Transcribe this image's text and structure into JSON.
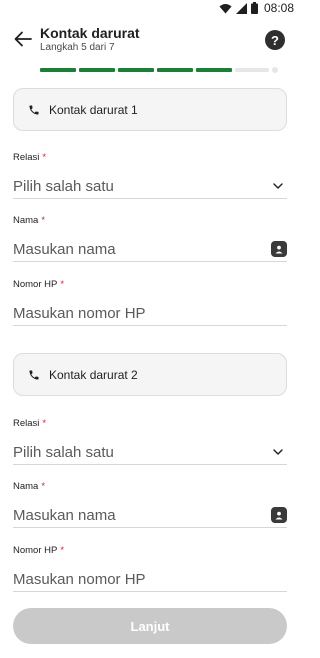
{
  "status_bar": {
    "time": "08:08"
  },
  "header": {
    "title": "Kontak darurat",
    "subtitle": "Langkah 5 dari 7",
    "help_label": "?"
  },
  "progress": {
    "current_step": 5,
    "total_steps": 7
  },
  "contacts": [
    {
      "section_title": "Kontak darurat 1",
      "relation": {
        "label": "Relasi",
        "required": "*",
        "placeholder": "Pilih salah satu"
      },
      "name": {
        "label": "Nama",
        "required": "*",
        "placeholder": "Masukan nama"
      },
      "phone": {
        "label": "Nomor HP",
        "required": "*",
        "placeholder": "Masukan nomor HP"
      }
    },
    {
      "section_title": "Kontak darurat 2",
      "relation": {
        "label": "Relasi",
        "required": "*",
        "placeholder": "Pilih salah satu"
      },
      "name": {
        "label": "Nama",
        "required": "*",
        "placeholder": "Masukan nama"
      },
      "phone": {
        "label": "Nomor HP",
        "required": "*",
        "placeholder": "Masukan nomor HP"
      }
    }
  ],
  "submit_label": "Lanjut",
  "colors": {
    "progress_done": "#1a7f37",
    "required": "#d61f26",
    "button_disabled": "#c9c9c9"
  },
  "icons": [
    "wifi-icon",
    "signal-icon",
    "battery-icon",
    "back-arrow-icon",
    "help-icon",
    "phone-icon",
    "chevron-down-icon",
    "contact-book-icon"
  ]
}
